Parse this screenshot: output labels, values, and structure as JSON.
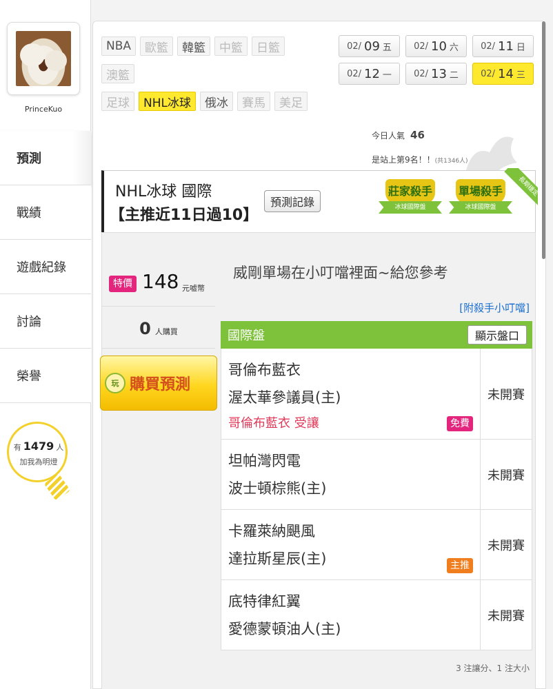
{
  "sidebar": {
    "username": "PrinceKuo",
    "nav": [
      "預測",
      "戰績",
      "遊戲紀錄",
      "討論",
      "榮譽"
    ],
    "fans": {
      "prefix": "有",
      "count": "1479",
      "suffix": "人",
      "label": "加我為明燈"
    }
  },
  "tags": [
    [
      {
        "label": "NBA",
        "state": "normal"
      },
      {
        "label": "歐籃",
        "state": "disabled"
      },
      {
        "label": "韓籃",
        "state": "normal"
      },
      {
        "label": "中籃",
        "state": "disabled"
      },
      {
        "label": "日籃",
        "state": "disabled"
      }
    ],
    [
      {
        "label": "澳籃",
        "state": "disabled"
      }
    ],
    [
      {
        "label": "足球",
        "state": "disabled"
      },
      {
        "label": "NHL冰球",
        "state": "active"
      },
      {
        "label": "俄冰",
        "state": "normal"
      },
      {
        "label": "賽馬",
        "state": "disabled"
      },
      {
        "label": "美足",
        "state": "disabled"
      }
    ]
  ],
  "dates": [
    {
      "md": "02/",
      "d": "09",
      "w": "五",
      "active": false
    },
    {
      "md": "02/",
      "d": "10",
      "w": "六",
      "active": false
    },
    {
      "md": "02/",
      "d": "11",
      "w": "日",
      "active": false
    },
    {
      "md": "02/",
      "d": "12",
      "w": "一",
      "active": false
    },
    {
      "md": "02/",
      "d": "13",
      "w": "二",
      "active": false
    },
    {
      "md": "02/",
      "d": "14",
      "w": "三",
      "active": true
    }
  ],
  "stats": {
    "popularity_label": "今日人氣",
    "popularity_value": "46",
    "ranking": "是站上第9名！！",
    "ranking_total": "(共1346人)"
  },
  "header": {
    "title": "NHL冰球 國際",
    "subtitle": "【主推近11日過10】",
    "record_button": "預測記錄",
    "badges": [
      {
        "title": "莊家殺手",
        "ribbon": "冰球國際盤"
      },
      {
        "title": "單場殺手",
        "ribbon": "冰球國際盤"
      }
    ],
    "corner_ribbon": "長期穩定"
  },
  "purchase": {
    "price_tag": "特價",
    "price": "148",
    "price_unit": "元嘘幣",
    "buyers": "0",
    "buyers_unit": "人購買",
    "buy_icon": "玩",
    "buy_button": "購買預測"
  },
  "description": "威剛單場在小叮噹裡面~給您參考",
  "link": "[附殺手小叮噹]",
  "bet_panel": {
    "title": "國際盤",
    "show_button": "顯示盤口",
    "games": [
      {
        "away": "哥倫布藍衣",
        "home": "渥太華參議員(主)",
        "note": "哥倫布藍衣 受讓",
        "badge": "免費",
        "badge_color": "#e4257e",
        "status": "未開賽"
      },
      {
        "away": "坦帕灣閃電",
        "home": "波士頓棕熊(主)",
        "note": "",
        "badge": "",
        "badge_color": "",
        "status": "未開賽"
      },
      {
        "away": "卡羅萊納颶風",
        "home": "達拉斯星辰(主)",
        "note": "",
        "badge": "主推",
        "badge_color": "#f07d1e",
        "status": "未開賽"
      },
      {
        "away": "底特律紅翼",
        "home": "愛德蒙頓油人(主)",
        "note": "",
        "badge": "",
        "badge_color": "",
        "status": "未開賽"
      }
    ]
  },
  "footer_note": "3 注讓分、1 注大小"
}
